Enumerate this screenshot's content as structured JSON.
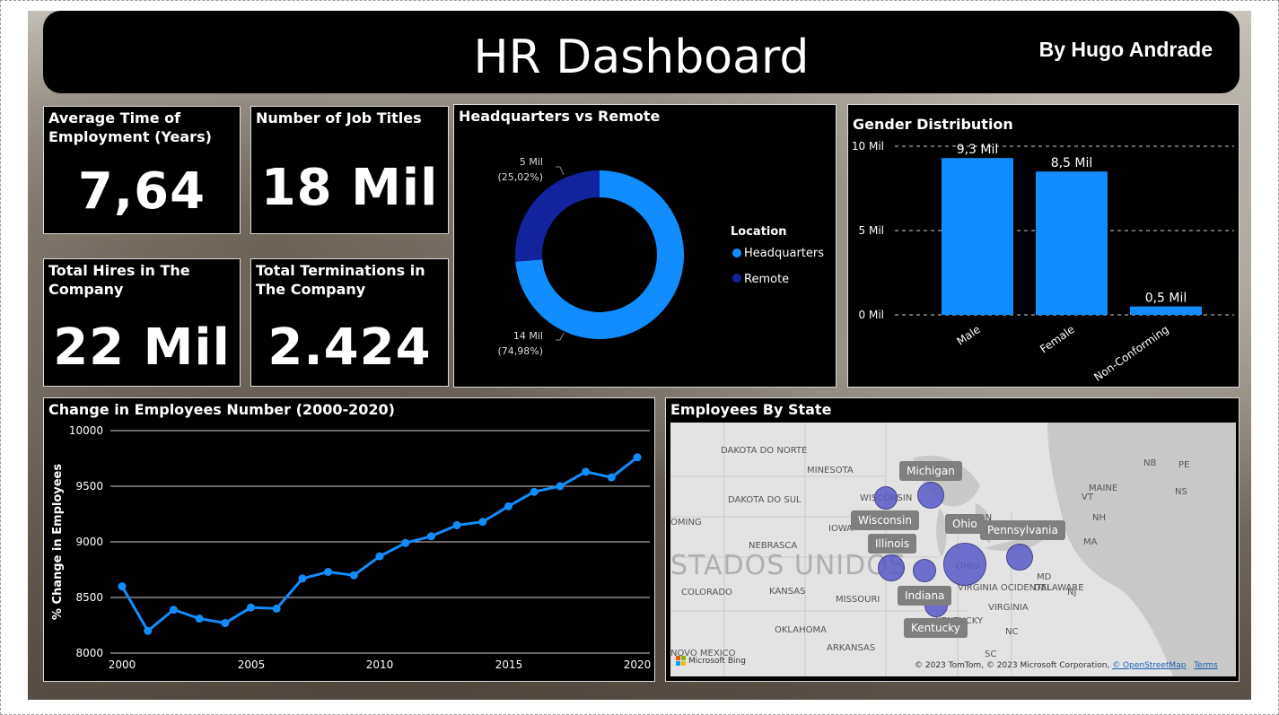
{
  "header": {
    "title": "HR Dashboard",
    "author": "By Hugo Andrade"
  },
  "cards": {
    "avg_time": {
      "label": "Average Time of Employment (Years)",
      "value": "7,64"
    },
    "job_titles": {
      "label": "Number of Job Titles",
      "value": "18 Mil"
    },
    "hires": {
      "label": "Total Hires in The Company",
      "value": "22 Mil"
    },
    "terminations": {
      "label": "Total Terminations in The Company",
      "value": "2.424"
    }
  },
  "donut": {
    "title": "Headquarters vs Remote",
    "legend_title": "Location",
    "colors": {
      "headquarters": "#118DFF",
      "remote": "#12239E"
    },
    "labels": {
      "remote_value": "5 Mil",
      "remote_pct": "(25,02%)",
      "hq_value": "14 Mil",
      "hq_pct": "(74,98%)"
    },
    "legend": [
      "Headquarters",
      "Remote"
    ]
  },
  "gender": {
    "title": "Gender Distribution",
    "bar_color": "#118DFF",
    "y_ticks": [
      "10 Mil",
      "5 Mil",
      "0 Mil"
    ],
    "data_labels": [
      "9,3 Mil",
      "8,5 Mil",
      "0,5 Mil"
    ]
  },
  "line": {
    "title": "Change in Employees Number (2000-2020)",
    "ylabel": "% Change in Employees",
    "line_color": "#118DFF",
    "y_ticks": [
      "10000",
      "9500",
      "9000",
      "8500",
      "8000"
    ],
    "x_ticks": [
      "2000",
      "2005",
      "2010",
      "2015",
      "2020"
    ]
  },
  "map": {
    "title": "Employees By State",
    "regions": [
      "DAKOTA DO NORTE",
      "MINESOTA",
      "DAKOTA DO SUL",
      "WISCONSIN",
      "MICHIGAN",
      "IOWA",
      "NEBRASCA",
      "KANSAS",
      "MISSOURI",
      "COLORADO",
      "OKLAHOMA",
      "ARKANSAS",
      "NOVO MEXICO",
      "VIRGINIA OCIDENTAL",
      "VIRGINIA",
      "KENTUCKY",
      "OHIO",
      "MAINE",
      "NB",
      "PE",
      "NS",
      "VT",
      "NH",
      "MD",
      "NJ",
      "DELAWARE",
      "NC",
      "SC",
      "OMING",
      "MA"
    ],
    "big_text": "STADOS UNIDOS",
    "callouts": [
      "Michigan",
      "Wisconsin",
      "Ohio",
      "Pennsylvania",
      "Illinois",
      "Indiana",
      "Kentucky"
    ],
    "bubble_color": "#5A5AC8",
    "bing": "Microsoft Bing",
    "copyright": "© 2023 TomTom, © 2023 Microsoft Corporation,",
    "osm": "© OpenStreetMap",
    "terms": "Terms"
  },
  "chart_data": [
    {
      "type": "pie",
      "title": "Headquarters vs Remote",
      "legend_title": "Location",
      "categories": [
        "Headquarters",
        "Remote"
      ],
      "values": [
        14000,
        5000
      ],
      "percent": [
        74.98,
        25.02
      ]
    },
    {
      "type": "bar",
      "title": "Gender Distribution",
      "categories": [
        "Male",
        "Female",
        "Non-Conforming"
      ],
      "values": [
        9300,
        8500,
        500
      ],
      "ylim": [
        0,
        10000
      ]
    },
    {
      "type": "line",
      "title": "Change in Employees Number (2000-2020)",
      "xlabel": "",
      "ylabel": "% Change in Employees",
      "x": [
        2000,
        2001,
        2002,
        2003,
        2004,
        2005,
        2006,
        2007,
        2008,
        2009,
        2010,
        2011,
        2012,
        2013,
        2014,
        2015,
        2016,
        2017,
        2018,
        2019,
        2020
      ],
      "values": [
        8600,
        8200,
        8390,
        8310,
        8270,
        8410,
        8400,
        8670,
        8730,
        8700,
        8870,
        8990,
        9050,
        9150,
        9180,
        9320,
        9450,
        9500,
        9630,
        9580,
        9760
      ],
      "ylim": [
        8000,
        10000
      ],
      "grid": true
    },
    {
      "type": "map",
      "title": "Employees By State",
      "categories": [
        "Ohio",
        "Pennsylvania",
        "Michigan",
        "Wisconsin",
        "Illinois",
        "Indiana",
        "Kentucky"
      ],
      "values": [
        10,
        3,
        3,
        2,
        3,
        2,
        2
      ]
    }
  ]
}
